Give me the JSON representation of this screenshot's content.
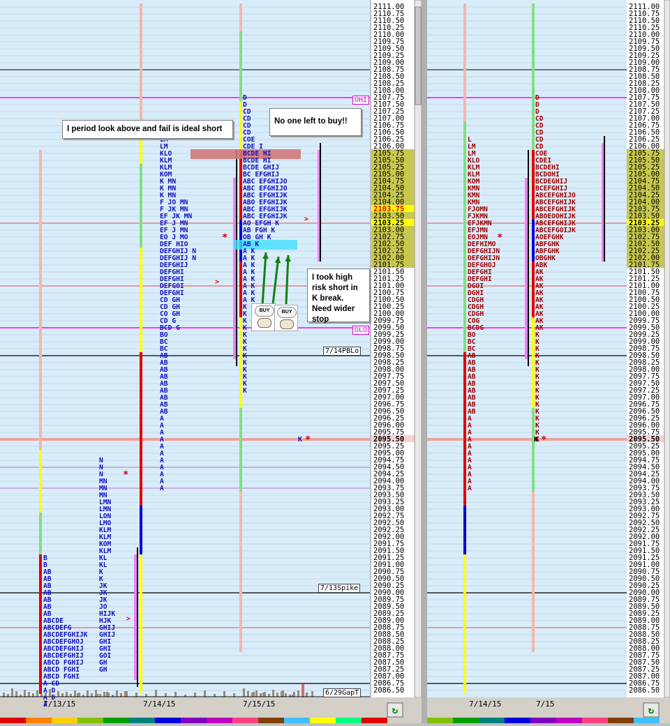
{
  "chart_data": [
    {
      "type": "market-profile",
      "panel": "left",
      "dates": [
        "7/13/15",
        "7/14/15",
        "7/15/15"
      ],
      "price_axis": {
        "max": 2111.0,
        "min": 2086.5,
        "step": 0.25
      },
      "highlighted_prices": [
        "2103.75",
        "2103.25",
        "2095.50"
      ],
      "value_area_band": [
        "2105.75",
        "2101.75"
      ],
      "reference_lines": [
        {
          "label": "OHI",
          "price": 2107.75,
          "color": "#ff00ff"
        },
        {
          "label": "OLO",
          "price": 2099.5,
          "color": "#ff00ff"
        },
        {
          "label": "7/14PBLo",
          "price": 2098.5,
          "color": "#000000"
        },
        {
          "label": "7/13Spike",
          "price": 2090.0,
          "color": "#000000"
        },
        {
          "label": "6/29GapT",
          "price": 2086.75,
          "color": "#000000"
        }
      ],
      "annotations": [
        "I period look above and fail is ideal short",
        "No one left to  buy!!",
        "I took high risk short in K break. Need wider stop"
      ],
      "icons": [
        "buy-sheep-icon",
        "buy-sheep-icon"
      ],
      "icon_labels": [
        "BUY",
        "BUY"
      ]
    },
    {
      "type": "market-profile",
      "panel": "right",
      "dates": [
        "7/14/15",
        "7/15"
      ],
      "price_axis": {
        "max": 2111.0,
        "min": 2086.5,
        "step": 0.25
      },
      "highlighted_prices": [
        "2103.25",
        "2095.50"
      ]
    }
  ],
  "profiles": {
    "p713": [
      "B",
      "B",
      "AB",
      "AB",
      "AB",
      "AB",
      "AB",
      "AB",
      "AB",
      "ABCDE",
      "ABCDEFG",
      "ABCDEFGHIJK",
      "ABCDEFGHOJ",
      "ABCDEFGHIJ",
      "ABCDEFGHIJ",
      "ABCD FGHIJ",
      "ABCD FGHI",
      "ABCD FGHI",
      "A CD",
      "A D",
      "A D",
      "A"
    ],
    "p713b": [
      "N",
      "N",
      "N",
      "MN",
      "MN",
      "MN",
      "LMN",
      "LMN",
      "LON",
      "LMO",
      "KLM",
      "KLM",
      "KOM",
      "KLM",
      "KL",
      "KL",
      "K",
      "K",
      "JK",
      "JK",
      "JK",
      "JO",
      "HIJK",
      "HJK",
      "GHIJ",
      "GHIJ",
      "GHI",
      "GHI",
      "GOI",
      "GH",
      "GH"
    ],
    "p714": [
      "L",
      "LM",
      "LM",
      "KLO",
      "KLM",
      "KLM",
      "KOM",
      "K MN",
      "K MN",
      "K MN",
      "F JO MN",
      "F JK MN",
      "EF JK MN",
      "EF J MN",
      "EF J MN",
      "EO J MO",
      "DEF HIO",
      "DEFGHIJ N",
      "DEFGHIJ N",
      "DEFGHIJ",
      "DEFGHI",
      "DEFGHI",
      "DEFGOI",
      "DEFGHI",
      "CD GH",
      "CD GH",
      "CO GH",
      "CD G",
      "BCD G",
      "BO",
      "BC",
      "BC",
      "AB",
      "AB",
      "AB",
      "AB",
      "AB",
      "AB",
      "AB",
      "AB",
      "AB",
      "A",
      "A",
      "A",
      "A",
      "A",
      "A",
      "A",
      "A",
      "A",
      "A",
      "A"
    ],
    "p715": [
      "D",
      "D",
      "CD",
      "CD",
      "CD",
      "CD",
      "COE",
      "CDE I",
      "BCDE HI",
      "BCDE HI",
      "BCDE GHIJ",
      "BC EFGHIJ",
      "ABC EFGHIJO",
      "ABC EFGHIJO",
      "ABC EFGHIJK",
      "ABO EFGHIJK",
      "ABC EFGHIJK",
      "ABC EFGHIJK",
      "AO EFGH K",
      "AB FGH K",
      "OB GH K",
      "AB K",
      "A K",
      "A K",
      "A K",
      "A K",
      "A K",
      "A K",
      "A K",
      "A K",
      "K",
      "K",
      "K",
      "K",
      "K",
      "K",
      "K",
      "K",
      "K",
      "K",
      "K",
      "K",
      "K"
    ],
    "r714": [
      "L",
      "LM",
      "LM",
      "KLO",
      "KLM",
      "KLM",
      "KOM",
      "KMN",
      "KMN",
      "KMN",
      "FJOMN",
      "FJKMN",
      "EFJKMN",
      "EFJMN",
      "EOJMN",
      "DEFHIMO",
      "DEFGHIJN",
      "DEFGHIJN",
      "DEFGHOJ",
      "DEFGHI",
      "DEFGHI",
      "DGOI",
      "DGHI",
      "CDGH",
      "CDGH",
      "CDGH",
      "COG",
      "BCDG",
      "BO",
      "BC",
      "BC",
      "AB",
      "AB",
      "AB",
      "AB",
      "AB",
      "AB",
      "AB",
      "AB",
      "AB",
      "A",
      "A",
      "A",
      "A",
      "A",
      "A",
      "A",
      "A",
      "A",
      "A",
      "A"
    ],
    "r715": [
      "D",
      "D",
      "D",
      "CD",
      "CD",
      "CD",
      "CD",
      "CD",
      "COE",
      "CDEI",
      "BCDEHI",
      "BCDOHI",
      "BCDEGHIJ",
      "BCEFGHIJ",
      "ABCEFGHIJO",
      "ABCEFGHIJK",
      "ABCEFGHIJK",
      "ABOEOOHIJK",
      "ABCEFGHIJK",
      "ABCEFGOIJK",
      "AOEFGHK",
      "ABFGHK",
      "ABFGHK",
      "OBGHK",
      "ABK",
      "AK",
      "AK",
      "AK",
      "AK",
      "AK",
      "AK",
      "AK",
      "AK",
      "AK",
      "K",
      "K",
      "K",
      "K",
      "K",
      "K",
      "K",
      "K",
      "K",
      "K",
      "K",
      "K",
      "K",
      "K",
      "K",
      "K"
    ],
    "k_star": "K*"
  }
}
